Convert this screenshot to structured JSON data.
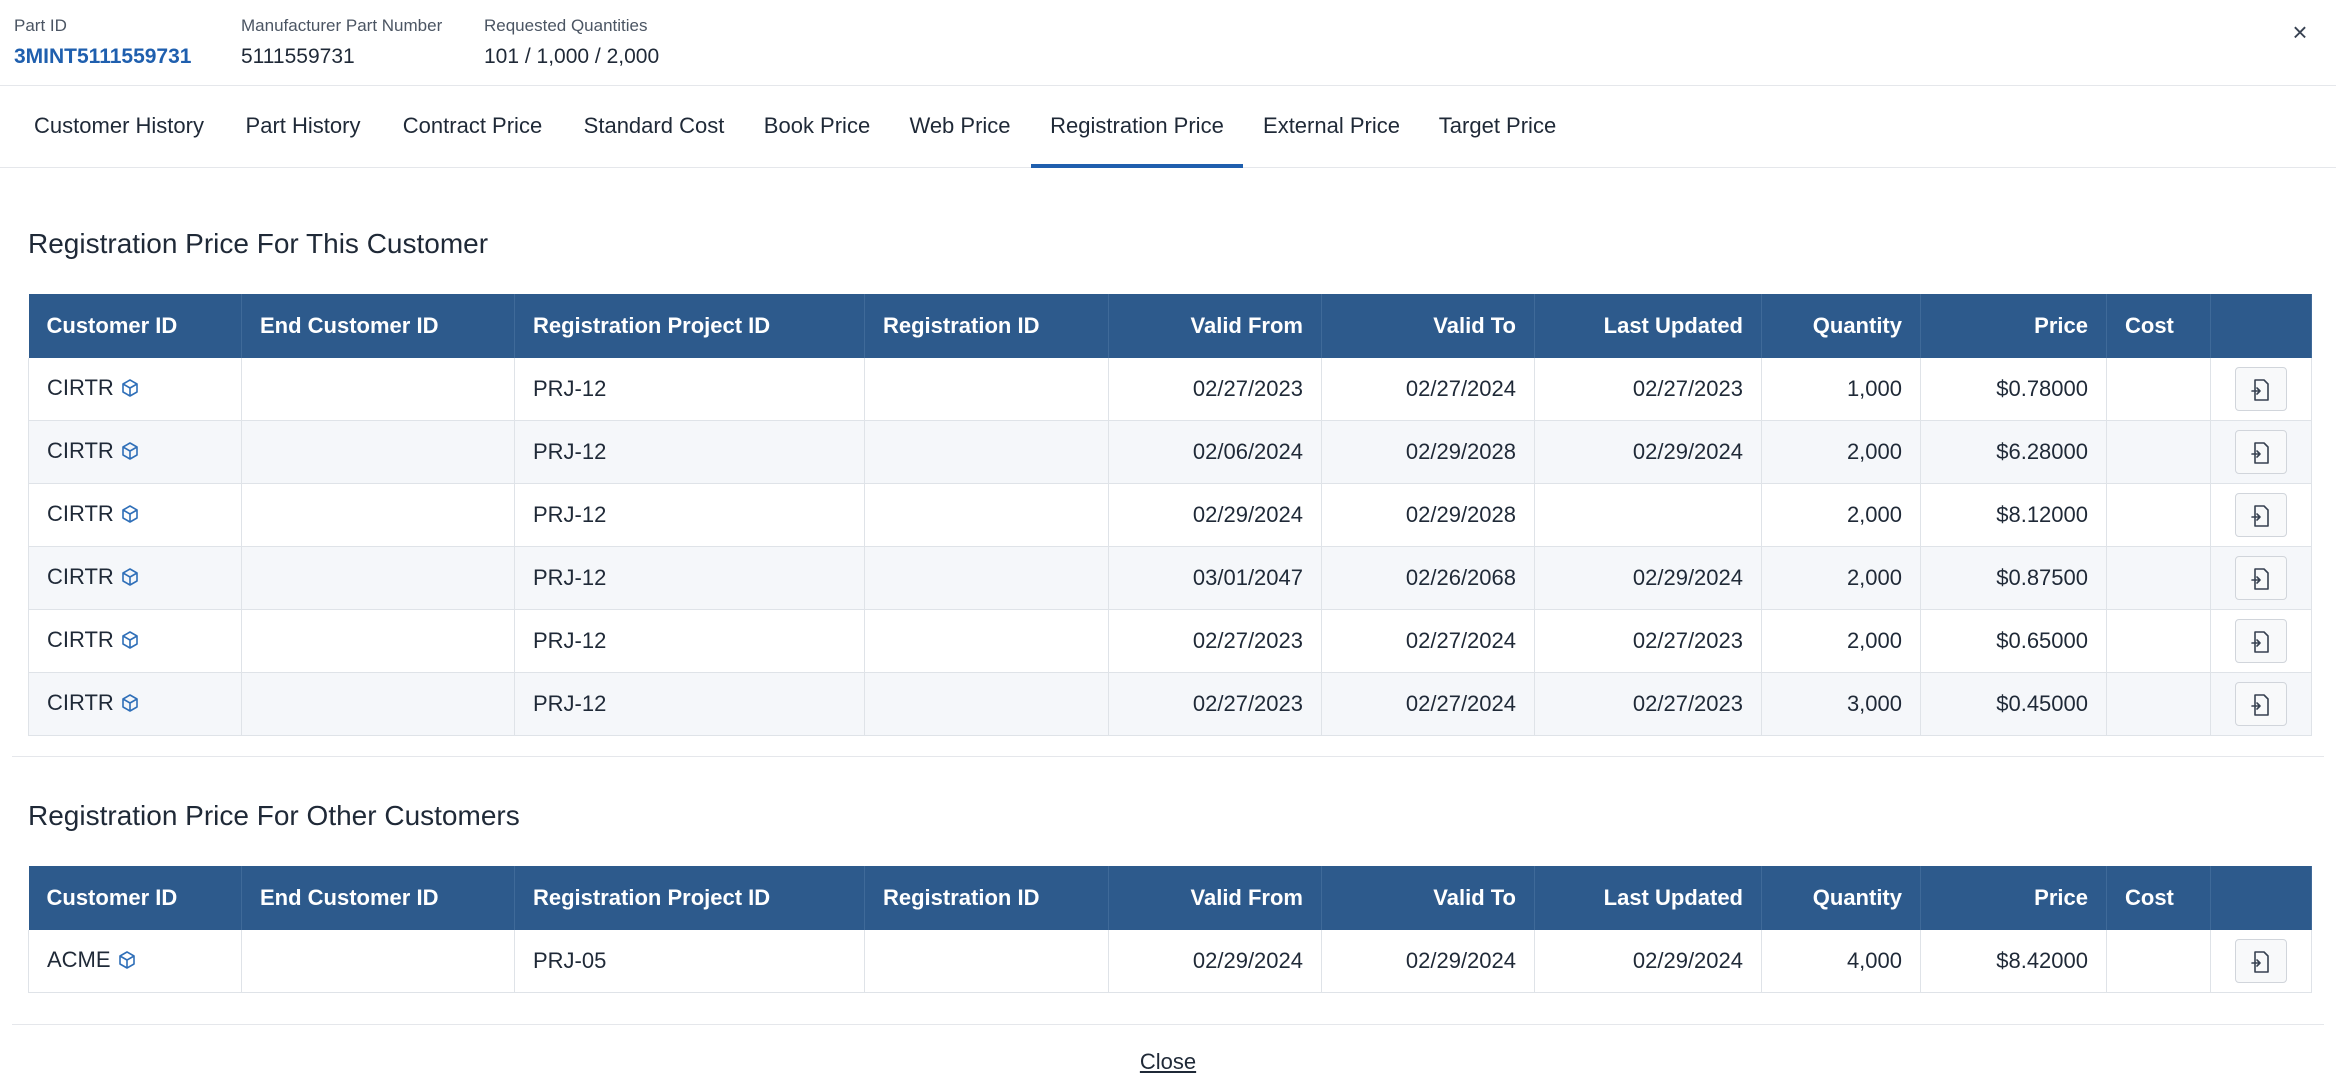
{
  "header": {
    "part_id_label": "Part ID",
    "part_id": "3MINT5111559731",
    "mpn_label": "Manufacturer Part Number",
    "mpn": "5111559731",
    "qty_label": "Requested Quantities",
    "qty": "101 / 1,000 / 2,000",
    "close_icon": "×"
  },
  "tabs": [
    "Customer History",
    "Part History",
    "Contract Price",
    "Standard Cost",
    "Book Price",
    "Web Price",
    "Registration Price",
    "External Price",
    "Target Price"
  ],
  "active_tab": "Registration Price",
  "columns": [
    "Customer ID",
    "End Customer ID",
    "Registration Project ID",
    "Registration ID",
    "Valid From",
    "Valid To",
    "Last Updated",
    "Quantity",
    "Price",
    "Cost"
  ],
  "this_customer": {
    "title": "Registration Price For This Customer",
    "rows": [
      {
        "customer": "CIRTR",
        "end_customer": "",
        "project": "PRJ-12",
        "reg_id": "",
        "valid_from": "02/27/2023",
        "valid_to": "02/27/2024",
        "expired": true,
        "last_updated": "02/27/2023",
        "quantity": "1,000",
        "price": "$0.78000",
        "cost": ""
      },
      {
        "customer": "CIRTR",
        "end_customer": "",
        "project": "PRJ-12",
        "reg_id": "",
        "valid_from": "02/06/2024",
        "valid_to": "02/29/2028",
        "expired": false,
        "last_updated": "02/29/2024",
        "quantity": "2,000",
        "price": "$6.28000",
        "cost": ""
      },
      {
        "customer": "CIRTR",
        "end_customer": "",
        "project": "PRJ-12",
        "reg_id": "",
        "valid_from": "02/29/2024",
        "valid_to": "02/29/2028",
        "expired": false,
        "last_updated": "",
        "quantity": "2,000",
        "price": "$8.12000",
        "cost": ""
      },
      {
        "customer": "CIRTR",
        "end_customer": "",
        "project": "PRJ-12",
        "reg_id": "",
        "valid_from": "03/01/2047",
        "valid_to": "02/26/2068",
        "expired": false,
        "last_updated": "02/29/2024",
        "quantity": "2,000",
        "price": "$0.87500",
        "cost": ""
      },
      {
        "customer": "CIRTR",
        "end_customer": "",
        "project": "PRJ-12",
        "reg_id": "",
        "valid_from": "02/27/2023",
        "valid_to": "02/27/2024",
        "expired": true,
        "last_updated": "02/27/2023",
        "quantity": "2,000",
        "price": "$0.65000",
        "cost": ""
      },
      {
        "customer": "CIRTR",
        "end_customer": "",
        "project": "PRJ-12",
        "reg_id": "",
        "valid_from": "02/27/2023",
        "valid_to": "02/27/2024",
        "expired": true,
        "last_updated": "02/27/2023",
        "quantity": "3,000",
        "price": "$0.45000",
        "cost": ""
      }
    ]
  },
  "other_customers": {
    "title": "Registration Price For Other Customers",
    "rows": [
      {
        "customer": "ACME",
        "end_customer": "",
        "project": "PRJ-05",
        "reg_id": "",
        "valid_from": "02/29/2024",
        "valid_to": "02/29/2024",
        "expired": true,
        "last_updated": "02/29/2024",
        "quantity": "4,000",
        "price": "$8.42000",
        "cost": ""
      }
    ]
  },
  "footer": {
    "close_label": "Close"
  },
  "colors": {
    "header_bg": "#2d5a8c",
    "accent": "#1f5fae",
    "expired": "#a83232"
  }
}
